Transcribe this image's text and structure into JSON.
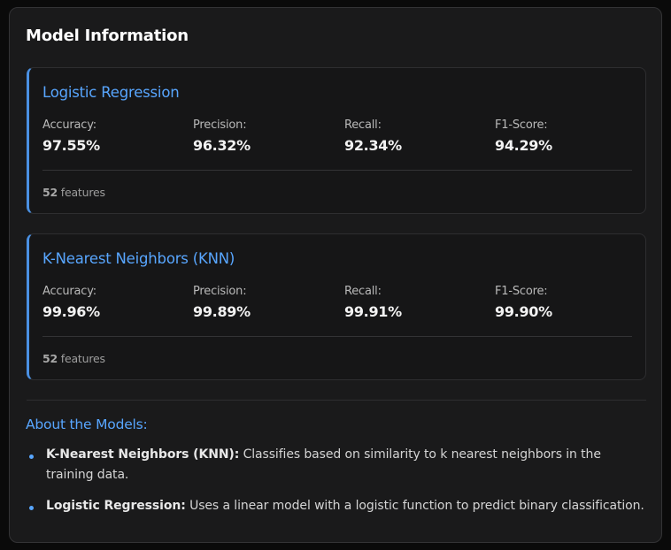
{
  "panel": {
    "title": "Model Information"
  },
  "models": [
    {
      "name": "Logistic Regression",
      "metrics": [
        {
          "label": "Accuracy:",
          "value": "97.55%"
        },
        {
          "label": "Precision:",
          "value": "96.32%"
        },
        {
          "label": "Recall:",
          "value": "92.34%"
        },
        {
          "label": "F1-Score:",
          "value": "94.29%"
        }
      ],
      "feature_count": "52",
      "feature_label": "features"
    },
    {
      "name": "K-Nearest Neighbors (KNN)",
      "metrics": [
        {
          "label": "Accuracy:",
          "value": "99.96%"
        },
        {
          "label": "Precision:",
          "value": "99.89%"
        },
        {
          "label": "Recall:",
          "value": "99.91%"
        },
        {
          "label": "F1-Score:",
          "value": "99.90%"
        }
      ],
      "feature_count": "52",
      "feature_label": "features"
    }
  ],
  "about": {
    "title": "About the Models:",
    "items": [
      {
        "term": "K-Nearest Neighbors (KNN):",
        "description": "Classifies based on similarity to k nearest neighbors in the training data."
      },
      {
        "term": "Logistic Regression:",
        "description": "Uses a linear model with a logistic function to predict binary classification."
      }
    ]
  },
  "colors": {
    "accent": "#58a6ff",
    "card_border_accent": "#4a90e2",
    "panel_background": "#1a1a1b",
    "page_background": "#0a0a0a"
  }
}
